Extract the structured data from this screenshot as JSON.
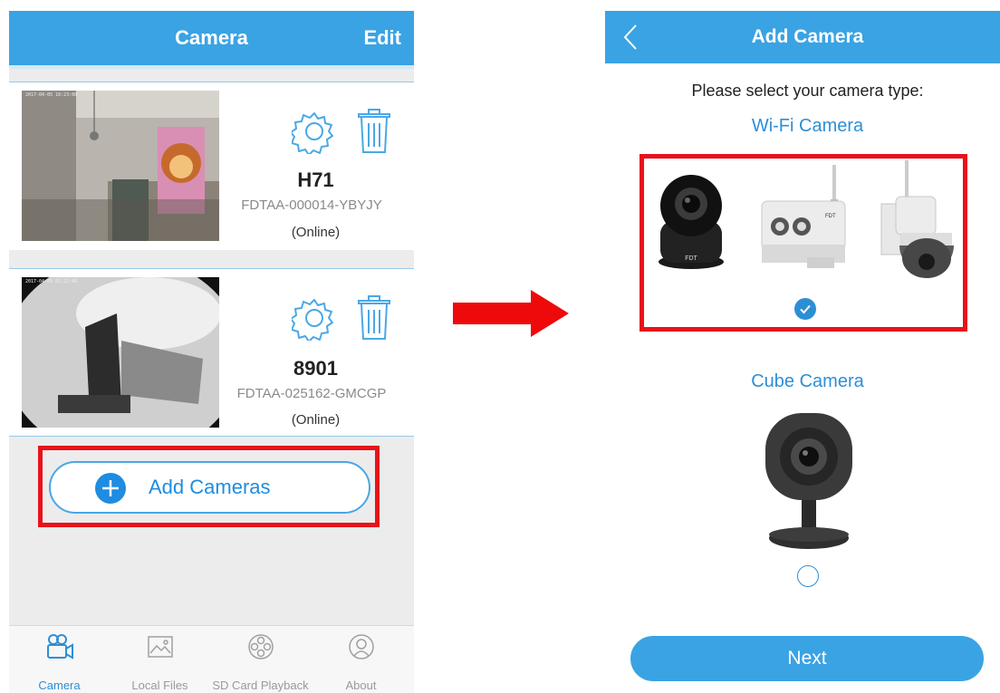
{
  "left_screen": {
    "title": "Camera",
    "edit": "Edit",
    "cameras": [
      {
        "name": "H71",
        "device_id": "FDTAA-000014-YBYJY",
        "status": "(Online)",
        "timestamp": "2017-04-05 16:23:08"
      },
      {
        "name": "8901",
        "device_id": "FDTAA-025162-GMCGP",
        "status": "(Online)",
        "timestamp": "2017-04-05 02:23:48"
      }
    ],
    "add_button": "Add Cameras",
    "tabs": [
      "Camera",
      "Local Files",
      "SD Card Playback",
      "About"
    ]
  },
  "right_screen": {
    "title": "Add Camera",
    "prompt": "Please select your camera type:",
    "wifi_label": "Wi-Fi Camera",
    "cube_label": "Cube Camera",
    "next_button": "Next",
    "brand": "FDT"
  },
  "colors": {
    "accent": "#3aa3e4",
    "highlight_red": "#e8121b",
    "link_blue": "#2c8fd6"
  }
}
